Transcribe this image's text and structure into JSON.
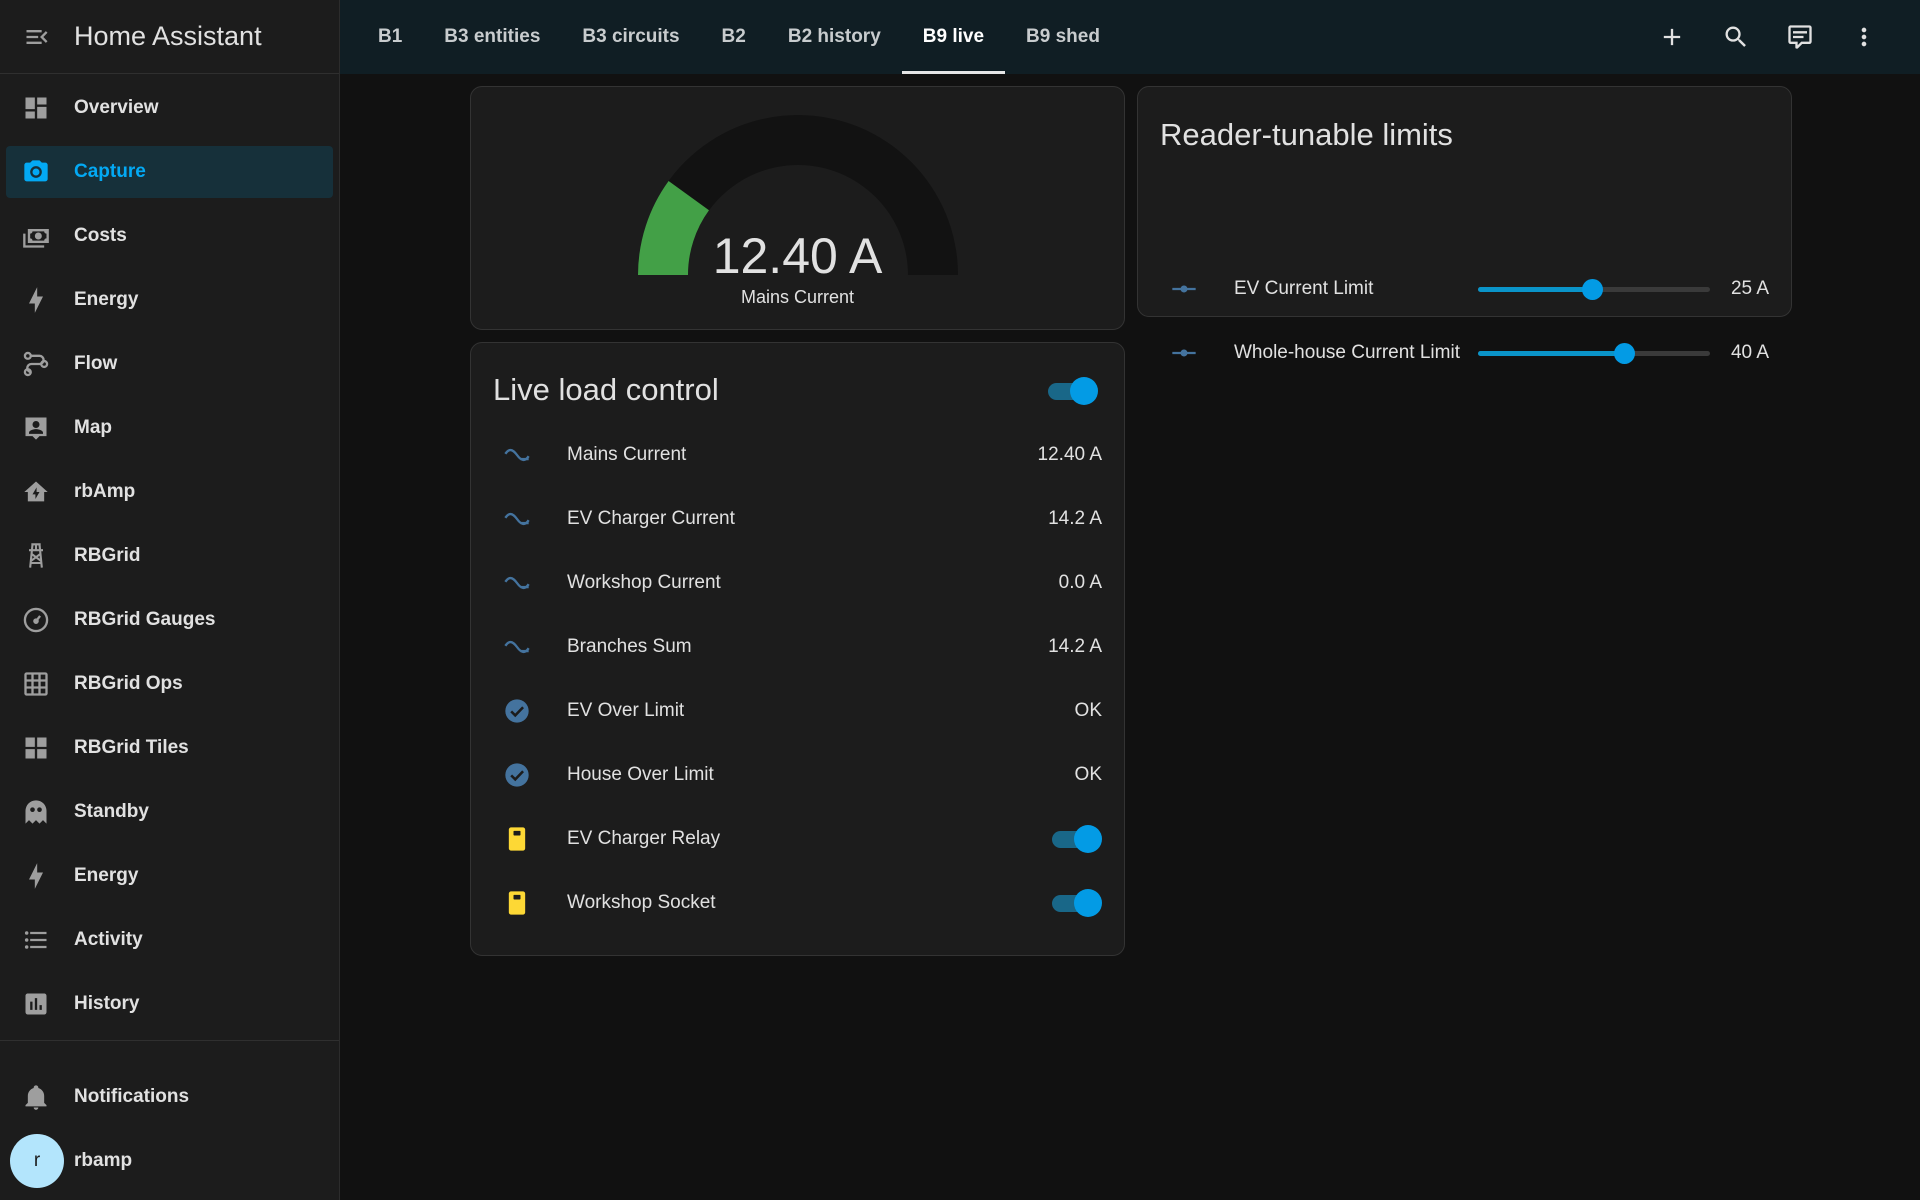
{
  "app": {
    "title": "Home Assistant"
  },
  "sidebar": {
    "items": [
      {
        "label": "Overview",
        "icon": "view-dashboard-icon"
      },
      {
        "label": "Capture",
        "icon": "camera-icon",
        "active": true
      },
      {
        "label": "Costs",
        "icon": "cash-icon"
      },
      {
        "label": "Energy",
        "icon": "lightning-bolt-icon"
      },
      {
        "label": "Flow",
        "icon": "flow-icon"
      },
      {
        "label": "Map",
        "icon": "map-account-icon"
      },
      {
        "label": "rbAmp",
        "icon": "home-lightning-icon"
      },
      {
        "label": "RBGrid",
        "icon": "transmission-tower-icon"
      },
      {
        "label": "RBGrid Gauges",
        "icon": "gauge-icon"
      },
      {
        "label": "RBGrid Ops",
        "icon": "grid-icon"
      },
      {
        "label": "RBGrid Tiles",
        "icon": "tiles-icon"
      },
      {
        "label": "Standby",
        "icon": "ghost-icon"
      },
      {
        "label": "Energy",
        "icon": "lightning-bolt-icon"
      },
      {
        "label": "Activity",
        "icon": "format-list-icon"
      },
      {
        "label": "History",
        "icon": "chart-box-icon"
      }
    ],
    "notifications": "Notifications",
    "user": {
      "name": "rbamp",
      "initial": "r"
    }
  },
  "tabs": [
    {
      "label": "B1"
    },
    {
      "label": "B3 entities"
    },
    {
      "label": "B3 circuits"
    },
    {
      "label": "B2"
    },
    {
      "label": "B2 history"
    },
    {
      "label": "B9 live",
      "active": true
    },
    {
      "label": "B9 shed"
    }
  ],
  "toolbar": {
    "icons": [
      "plus-icon",
      "search-icon",
      "assist-icon",
      "dots-vertical-icon"
    ]
  },
  "gauge": {
    "value": "12.40 A",
    "name": "Mains Current",
    "level_fraction": 0.2,
    "color": "#43a047"
  },
  "limits": {
    "title": "Reader-tunable limits",
    "rows": [
      {
        "name": "EV Current Limit",
        "value": "25 A",
        "fraction": 0.49
      },
      {
        "name": "Whole-house Current Limit",
        "value": "40 A",
        "fraction": 0.63
      }
    ]
  },
  "live": {
    "title": "Live load control",
    "header_toggle_on": true,
    "rows": [
      {
        "name": "Mains Current",
        "value": "12.40 A",
        "icon": "current-ac-icon"
      },
      {
        "name": "EV Charger Current",
        "value": "14.2 A",
        "icon": "current-ac-icon"
      },
      {
        "name": "Workshop Current",
        "value": "0.0 A",
        "icon": "current-ac-icon"
      },
      {
        "name": "Branches Sum",
        "value": "14.2 A",
        "icon": "current-ac-icon"
      },
      {
        "name": "EV Over Limit",
        "value": "OK",
        "icon": "check-circle-icon"
      },
      {
        "name": "House Over Limit",
        "value": "OK",
        "icon": "check-circle-icon"
      },
      {
        "name": "EV Charger Relay",
        "icon": "power-socket-icon",
        "toggle": true
      },
      {
        "name": "Workshop Socket",
        "icon": "power-socket-icon",
        "toggle": true
      }
    ]
  },
  "colors": {
    "accent": "#03a9f4",
    "icon_state": "#44739e",
    "outlet": "#fdd835"
  }
}
